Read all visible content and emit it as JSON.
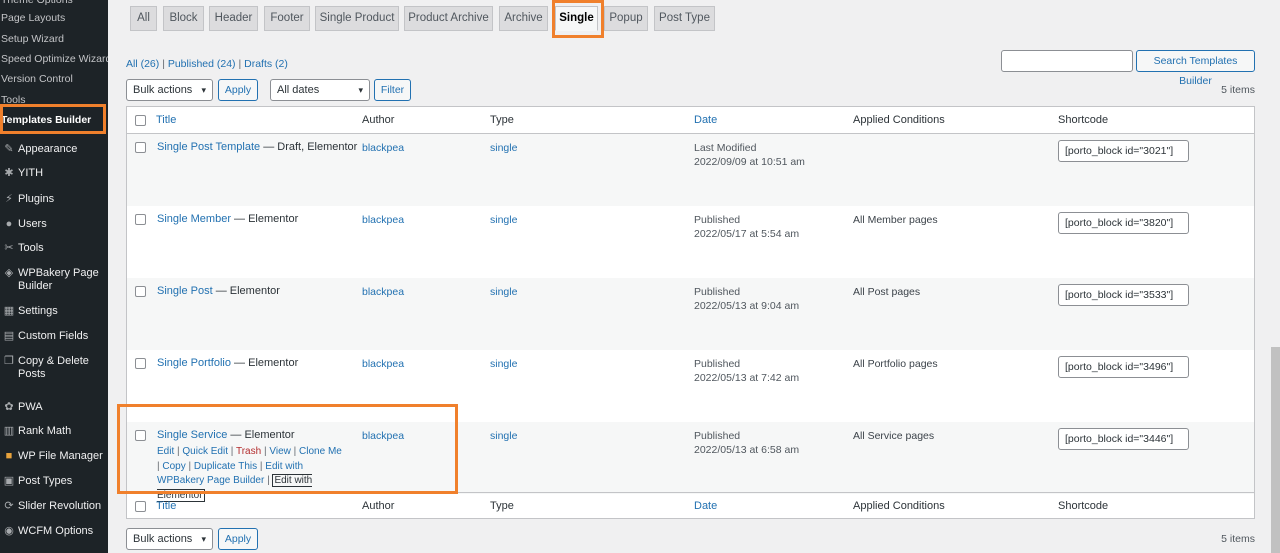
{
  "sidebar": {
    "submenu": [
      "Theme Options",
      "Page Layouts",
      "Setup Wizard",
      "Speed Optimize Wizard",
      "Version Control",
      "Tools",
      "Templates Builder"
    ],
    "menu": [
      {
        "label": "Appearance",
        "icon": "paintbrush-icon"
      },
      {
        "label": "YITH",
        "icon": "yith-icon"
      },
      {
        "label": "Plugins",
        "icon": "plugin-icon"
      },
      {
        "label": "Users",
        "icon": "users-icon"
      },
      {
        "label": "Tools",
        "icon": "wrench-icon"
      },
      {
        "label": "WPBakery Page Builder",
        "icon": "wpbakery-icon"
      },
      {
        "label": "Settings",
        "icon": "settings-icon"
      },
      {
        "label": "Custom Fields",
        "icon": "fields-icon"
      },
      {
        "label": "Copy & Delete Posts",
        "icon": "copy-icon"
      },
      {
        "label": "PWA",
        "icon": "pwa-icon"
      },
      {
        "label": "Rank Math",
        "icon": "rankmath-icon"
      },
      {
        "label": "WP File Manager",
        "icon": "filemanager-icon"
      },
      {
        "label": "Post Types",
        "icon": "posttypes-icon"
      },
      {
        "label": "Slider Revolution",
        "icon": "slider-icon"
      },
      {
        "label": "WCFM Options",
        "icon": "wcfm-icon"
      }
    ]
  },
  "tabs": [
    "All",
    "Block",
    "Header",
    "Footer",
    "Single Product",
    "Product Archive",
    "Archive",
    "Single",
    "Popup",
    "Post Type"
  ],
  "filters": {
    "all": "All (26)",
    "published": "Published (24)",
    "drafts": "Drafts (2)",
    "sep": "|"
  },
  "toolbar": {
    "bulk_actions": "Bulk actions",
    "apply": "Apply",
    "all_dates": "All dates",
    "filter": "Filter",
    "search_button": "Search Templates Builder",
    "items_count": "5 items"
  },
  "columns": {
    "title": "Title",
    "author": "Author",
    "type": "Type",
    "date": "Date",
    "conditions": "Applied Conditions",
    "shortcode": "Shortcode"
  },
  "rows": [
    {
      "title": "Single Post Template",
      "state": " — Draft, Elementor",
      "author": "blackpea",
      "type": "single",
      "status": "Last Modified",
      "date": "2022/09/09 at 10:51 am",
      "conditions": "",
      "shortcode": "[porto_block id=\"3021\"]"
    },
    {
      "title": "Single Member",
      "state": " — Elementor",
      "author": "blackpea",
      "type": "single",
      "status": "Published",
      "date": "2022/05/17 at 5:54 am",
      "conditions": "All Member pages",
      "shortcode": "[porto_block id=\"3820\"]"
    },
    {
      "title": "Single Post",
      "state": " — Elementor",
      "author": "blackpea",
      "type": "single",
      "status": "Published",
      "date": "2022/05/13 at 9:04 am",
      "conditions": "All Post pages",
      "shortcode": "[porto_block id=\"3533\"]"
    },
    {
      "title": "Single Portfolio",
      "state": " — Elementor",
      "author": "blackpea",
      "type": "single",
      "status": "Published",
      "date": "2022/05/13 at 7:42 am",
      "conditions": "All Portfolio pages",
      "shortcode": "[porto_block id=\"3496\"]"
    },
    {
      "title": "Single Service",
      "state": " — Elementor",
      "author": "blackpea",
      "type": "single",
      "status": "Published",
      "date": "2022/05/13 at 6:58 am",
      "conditions": "All Service pages",
      "shortcode": "[porto_block id=\"3446\"]"
    }
  ],
  "row_actions": {
    "edit": "Edit",
    "quick_edit": "Quick Edit",
    "trash": "Trash",
    "view": "View",
    "clone": "Clone Me",
    "copy": "Copy",
    "duplicate": "Duplicate This",
    "wpbakery": "Edit with WPBakery Page Builder",
    "elementor": "Edit with Elementor",
    "sep": "|"
  },
  "colors": {
    "accent": "#2271b1",
    "highlight": "#f0802c",
    "sidebar_bg": "#1d2327"
  }
}
